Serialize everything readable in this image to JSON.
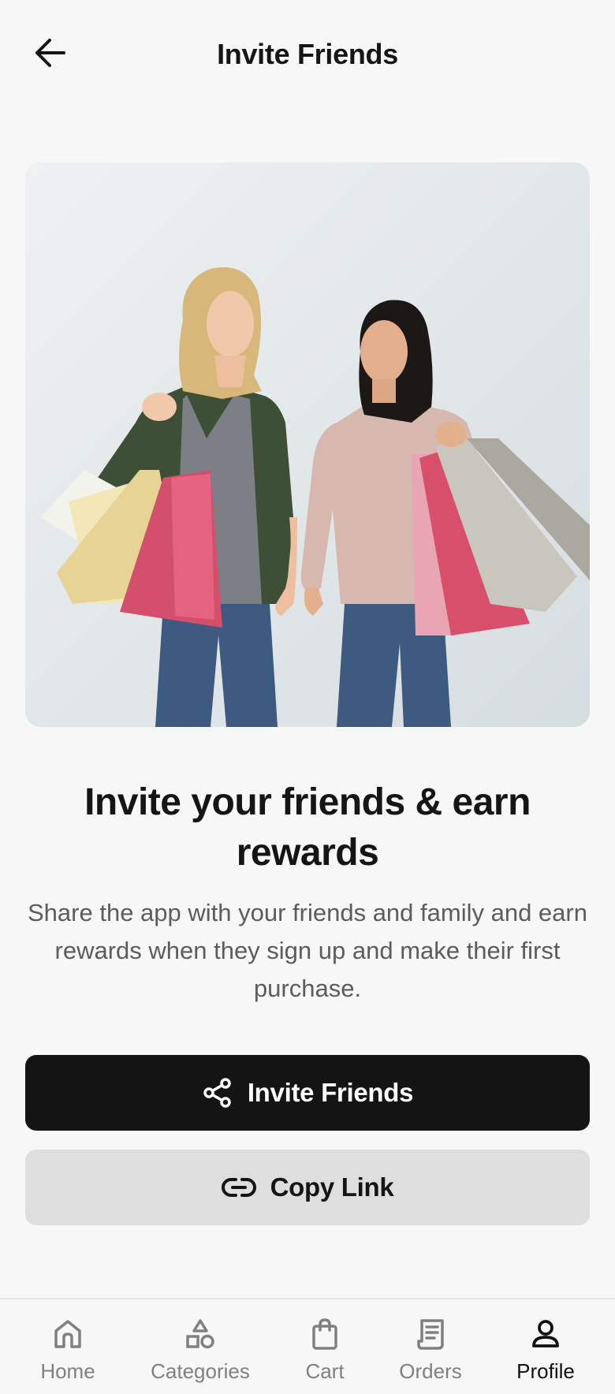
{
  "header": {
    "title": "Invite Friends",
    "back_icon": "arrow-left-icon"
  },
  "hero": {
    "image_name": "friends-shopping-image"
  },
  "content": {
    "headline": "Invite your friends & earn rewards",
    "description": "Share the app with your friends and family and earn rewards when they sign up and make their first purchase."
  },
  "buttons": {
    "invite_label": "Invite Friends",
    "invite_icon": "share-icon",
    "copy_label": "Copy Link",
    "copy_icon": "link-icon"
  },
  "nav": {
    "items": [
      {
        "label": "Home",
        "icon": "home-icon",
        "active": false
      },
      {
        "label": "Categories",
        "icon": "categories-icon",
        "active": false
      },
      {
        "label": "Cart",
        "icon": "shopping-bag-icon",
        "active": false
      },
      {
        "label": "Orders",
        "icon": "receipt-icon",
        "active": false
      },
      {
        "label": "Profile",
        "icon": "user-icon",
        "active": true
      }
    ]
  },
  "colors": {
    "primary_button": "#141414",
    "secondary_button": "#dedede",
    "background": "#f7f7f7",
    "active_nav": "#111111",
    "inactive_nav": "#808080"
  }
}
